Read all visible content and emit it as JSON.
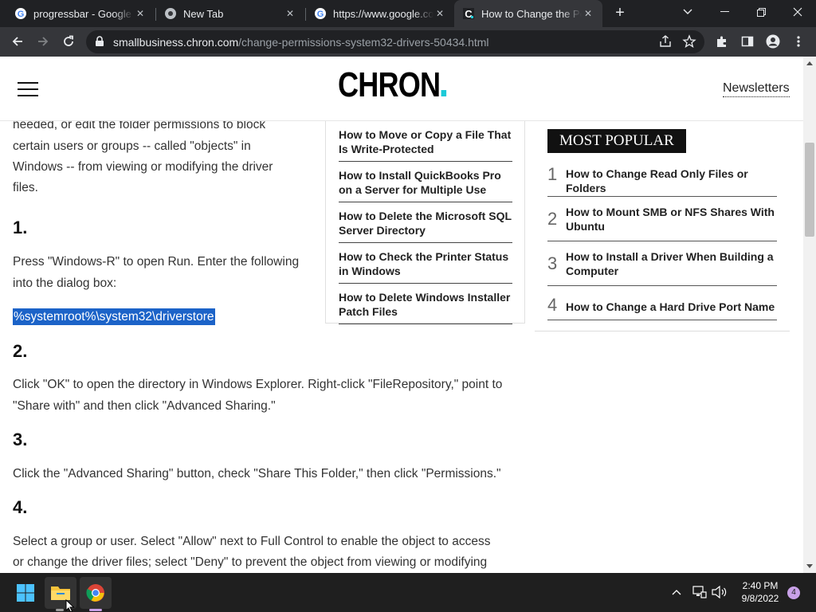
{
  "browser": {
    "tabs": [
      {
        "title": "progressbar - Google S",
        "favicon": "google-icon",
        "active": false
      },
      {
        "title": "New Tab",
        "favicon": "chrome-icon",
        "active": false
      },
      {
        "title": "https://www.google.co",
        "favicon": "google-icon",
        "active": false
      },
      {
        "title": "How to Change the Per",
        "favicon": "chron-favicon",
        "active": true
      }
    ],
    "url_host": "smallbusiness.chron.com",
    "url_path": "/change-permissions-system32-drivers-50434.html"
  },
  "site": {
    "logo": "CHRON",
    "newsletters": "Newsletters"
  },
  "article": {
    "intro_lines": [
      "needed, or edit the folder permissions to block",
      "certain users or groups -- called \"objects\" in",
      "Windows -- from viewing or modifying the driver",
      "files."
    ],
    "step1_heading": "1.",
    "step1_lines": [
      "Press \"Windows-R\" to open Run. Enter the following",
      "into the dialog box:"
    ],
    "highlight": "%systemroot%\\system32\\driverstore",
    "step2_heading": "2.",
    "step2_lines": [
      "Click \"OK\" to open the directory in Windows Explorer. Right-click \"FileRepository,\" point to",
      "\"Share with\" and then click \"Advanced Sharing.\""
    ],
    "step3_heading": "3.",
    "step3_text": "Click the \"Advanced Sharing\" button, check \"Share This Folder,\" then click \"Permissions.\"",
    "step4_heading": "4.",
    "step4_lines": [
      "Select a group or user. Select \"Allow\" next to Full Control to enable the object to access",
      "or change the driver files; select \"Deny\" to prevent the object from viewing or modifying"
    ]
  },
  "related": [
    "How to Move or Copy a File That Is Write-Protected",
    "How to Install QuickBooks Pro on a Server for Multiple Use",
    "How to Delete the Microsoft SQL Server Directory",
    "How to Check the Printer Status in Windows",
    "How to Delete Windows Installer Patch Files"
  ],
  "most_popular": {
    "label": "MOST POPULAR",
    "items": [
      {
        "num": "1",
        "title": "How to Change Read Only Files or Folders"
      },
      {
        "num": "2",
        "title": "How to Mount SMB or NFS Shares With Ubuntu"
      },
      {
        "num": "3",
        "title": "How to Install a Driver When Building a Computer"
      },
      {
        "num": "4",
        "title": "How to Change a Hard Drive Port Name"
      }
    ]
  },
  "taskbar": {
    "time": "2:40 PM",
    "date": "9/8/2022",
    "notification_count": "4"
  }
}
